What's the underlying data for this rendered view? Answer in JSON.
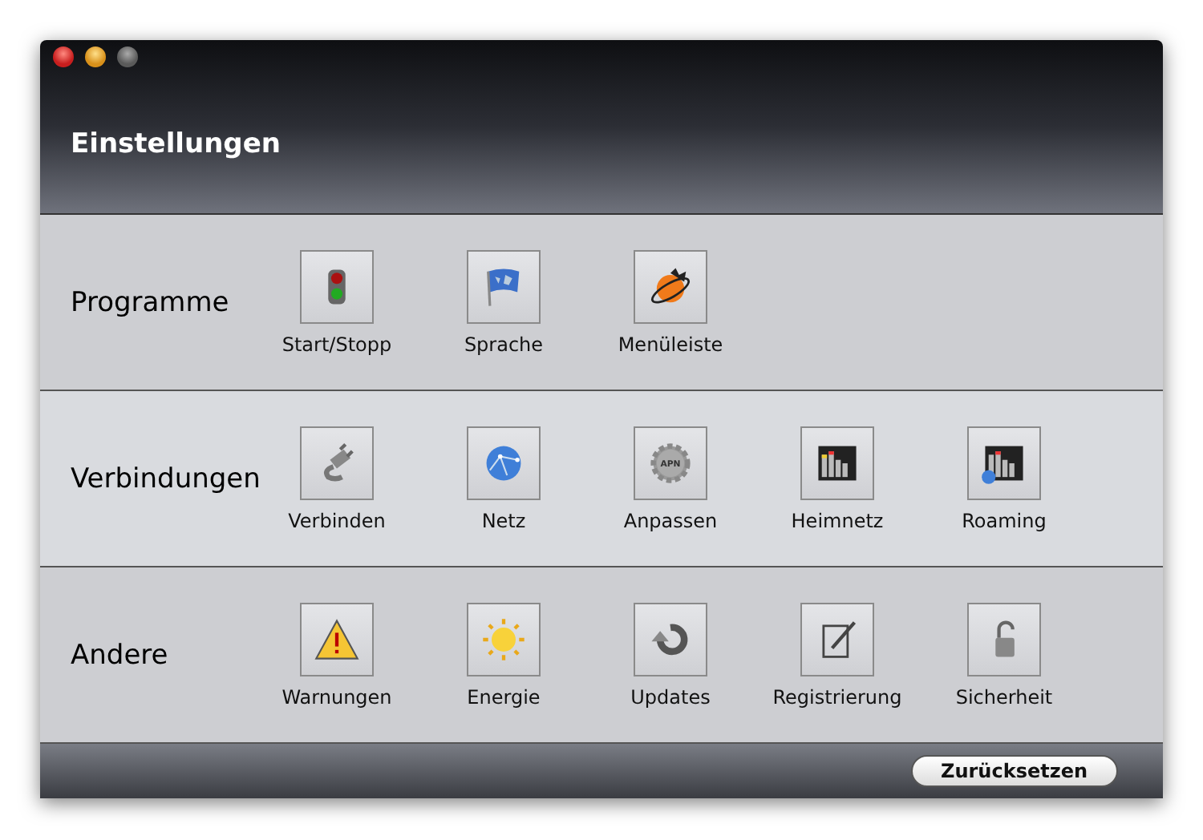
{
  "window": {
    "title": "Einstellungen",
    "controls": [
      {
        "kind": "close"
      },
      {
        "kind": "minimize"
      },
      {
        "kind": "zoom"
      }
    ]
  },
  "sections": [
    {
      "title": "Programme",
      "items": [
        {
          "label": "Start/Stopp",
          "kind": "traffic-light"
        },
        {
          "label": "Sprache",
          "kind": "flag"
        },
        {
          "label": "Menüleiste",
          "kind": "planet"
        }
      ]
    },
    {
      "title": "Verbindungen",
      "items": [
        {
          "label": "Verbinden",
          "kind": "plug"
        },
        {
          "label": "Netz",
          "kind": "globe"
        },
        {
          "label": "Anpassen",
          "kind": "gear",
          "badge": "APN"
        },
        {
          "label": "Heimnetz",
          "kind": "meter"
        },
        {
          "label": "Roaming",
          "kind": "meter-globe"
        }
      ]
    },
    {
      "title": "Andere",
      "items": [
        {
          "label": "Warnungen",
          "kind": "warning"
        },
        {
          "label": "Energie",
          "kind": "sun"
        },
        {
          "label": "Updates",
          "kind": "refresh"
        },
        {
          "label": "Registrierung",
          "kind": "pen"
        },
        {
          "label": "Sicherheit",
          "kind": "lock"
        }
      ]
    }
  ],
  "footer": {
    "button": "Zurücksetzen"
  }
}
